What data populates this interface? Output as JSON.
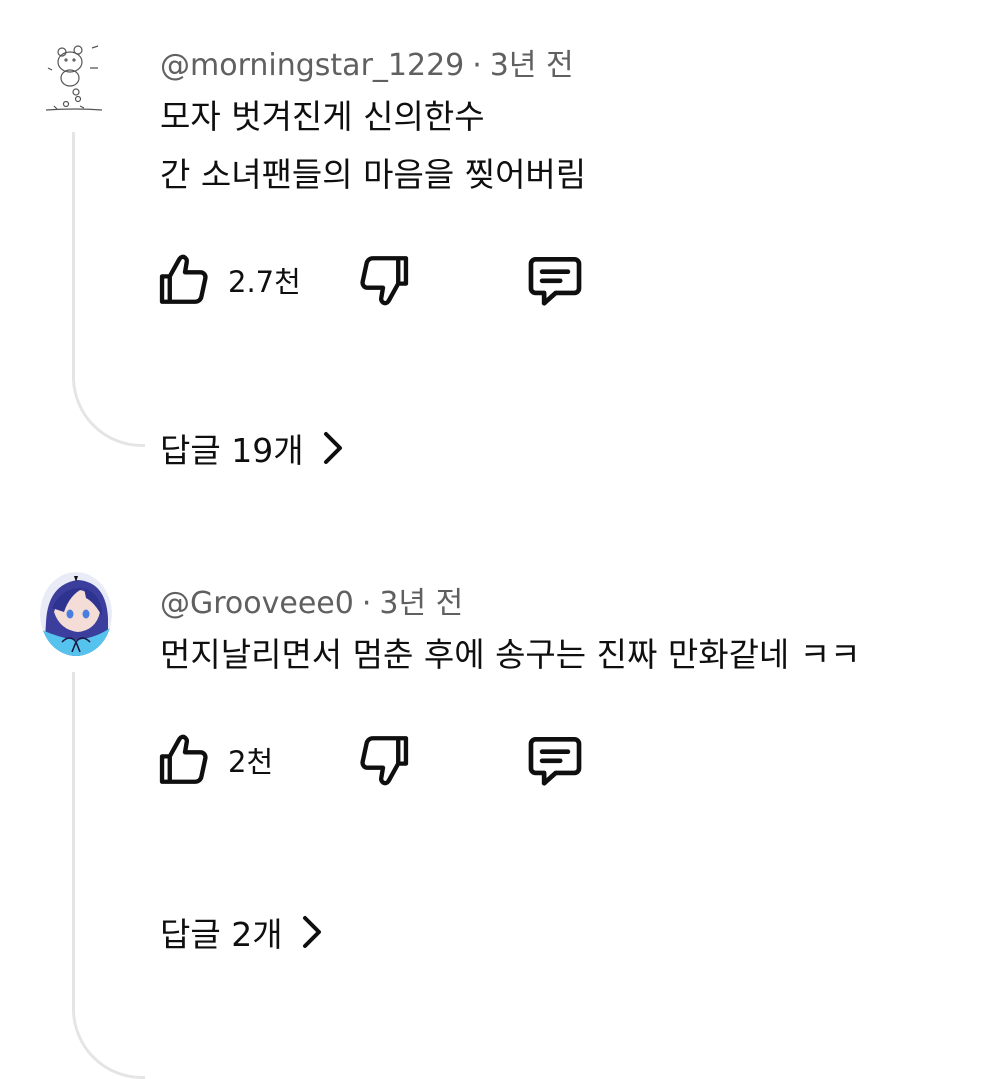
{
  "comments": [
    {
      "author": "@morningstar_1229",
      "separator": "·",
      "time": "3년 전",
      "lines": [
        "모자 벗겨진게 신의한수",
        "간 소녀팬들의 마음을 찢어버림"
      ],
      "likes": "2.7천",
      "replies": "답글 19개",
      "avatar_icon": "sketch-bear-avatar"
    },
    {
      "author": "@Grooveee0",
      "separator": "·",
      "time": "3년 전",
      "lines": [
        "먼지날리면서 멈춘 후에 송구는 진짜 만화같네 ㅋㅋ"
      ],
      "likes": "2천",
      "replies": "답글 2개",
      "avatar_icon": "anime-character-avatar"
    }
  ],
  "icons": {
    "like": "thumbs-up-icon",
    "dislike": "thumbs-down-icon",
    "reply": "comment-icon",
    "chevron": "chevron-right-icon"
  },
  "colors": {
    "text": "#0f0f0f",
    "meta": "#606060",
    "thread_line": "#e5e5e5",
    "avatar_blue": "#3a6fd8"
  }
}
